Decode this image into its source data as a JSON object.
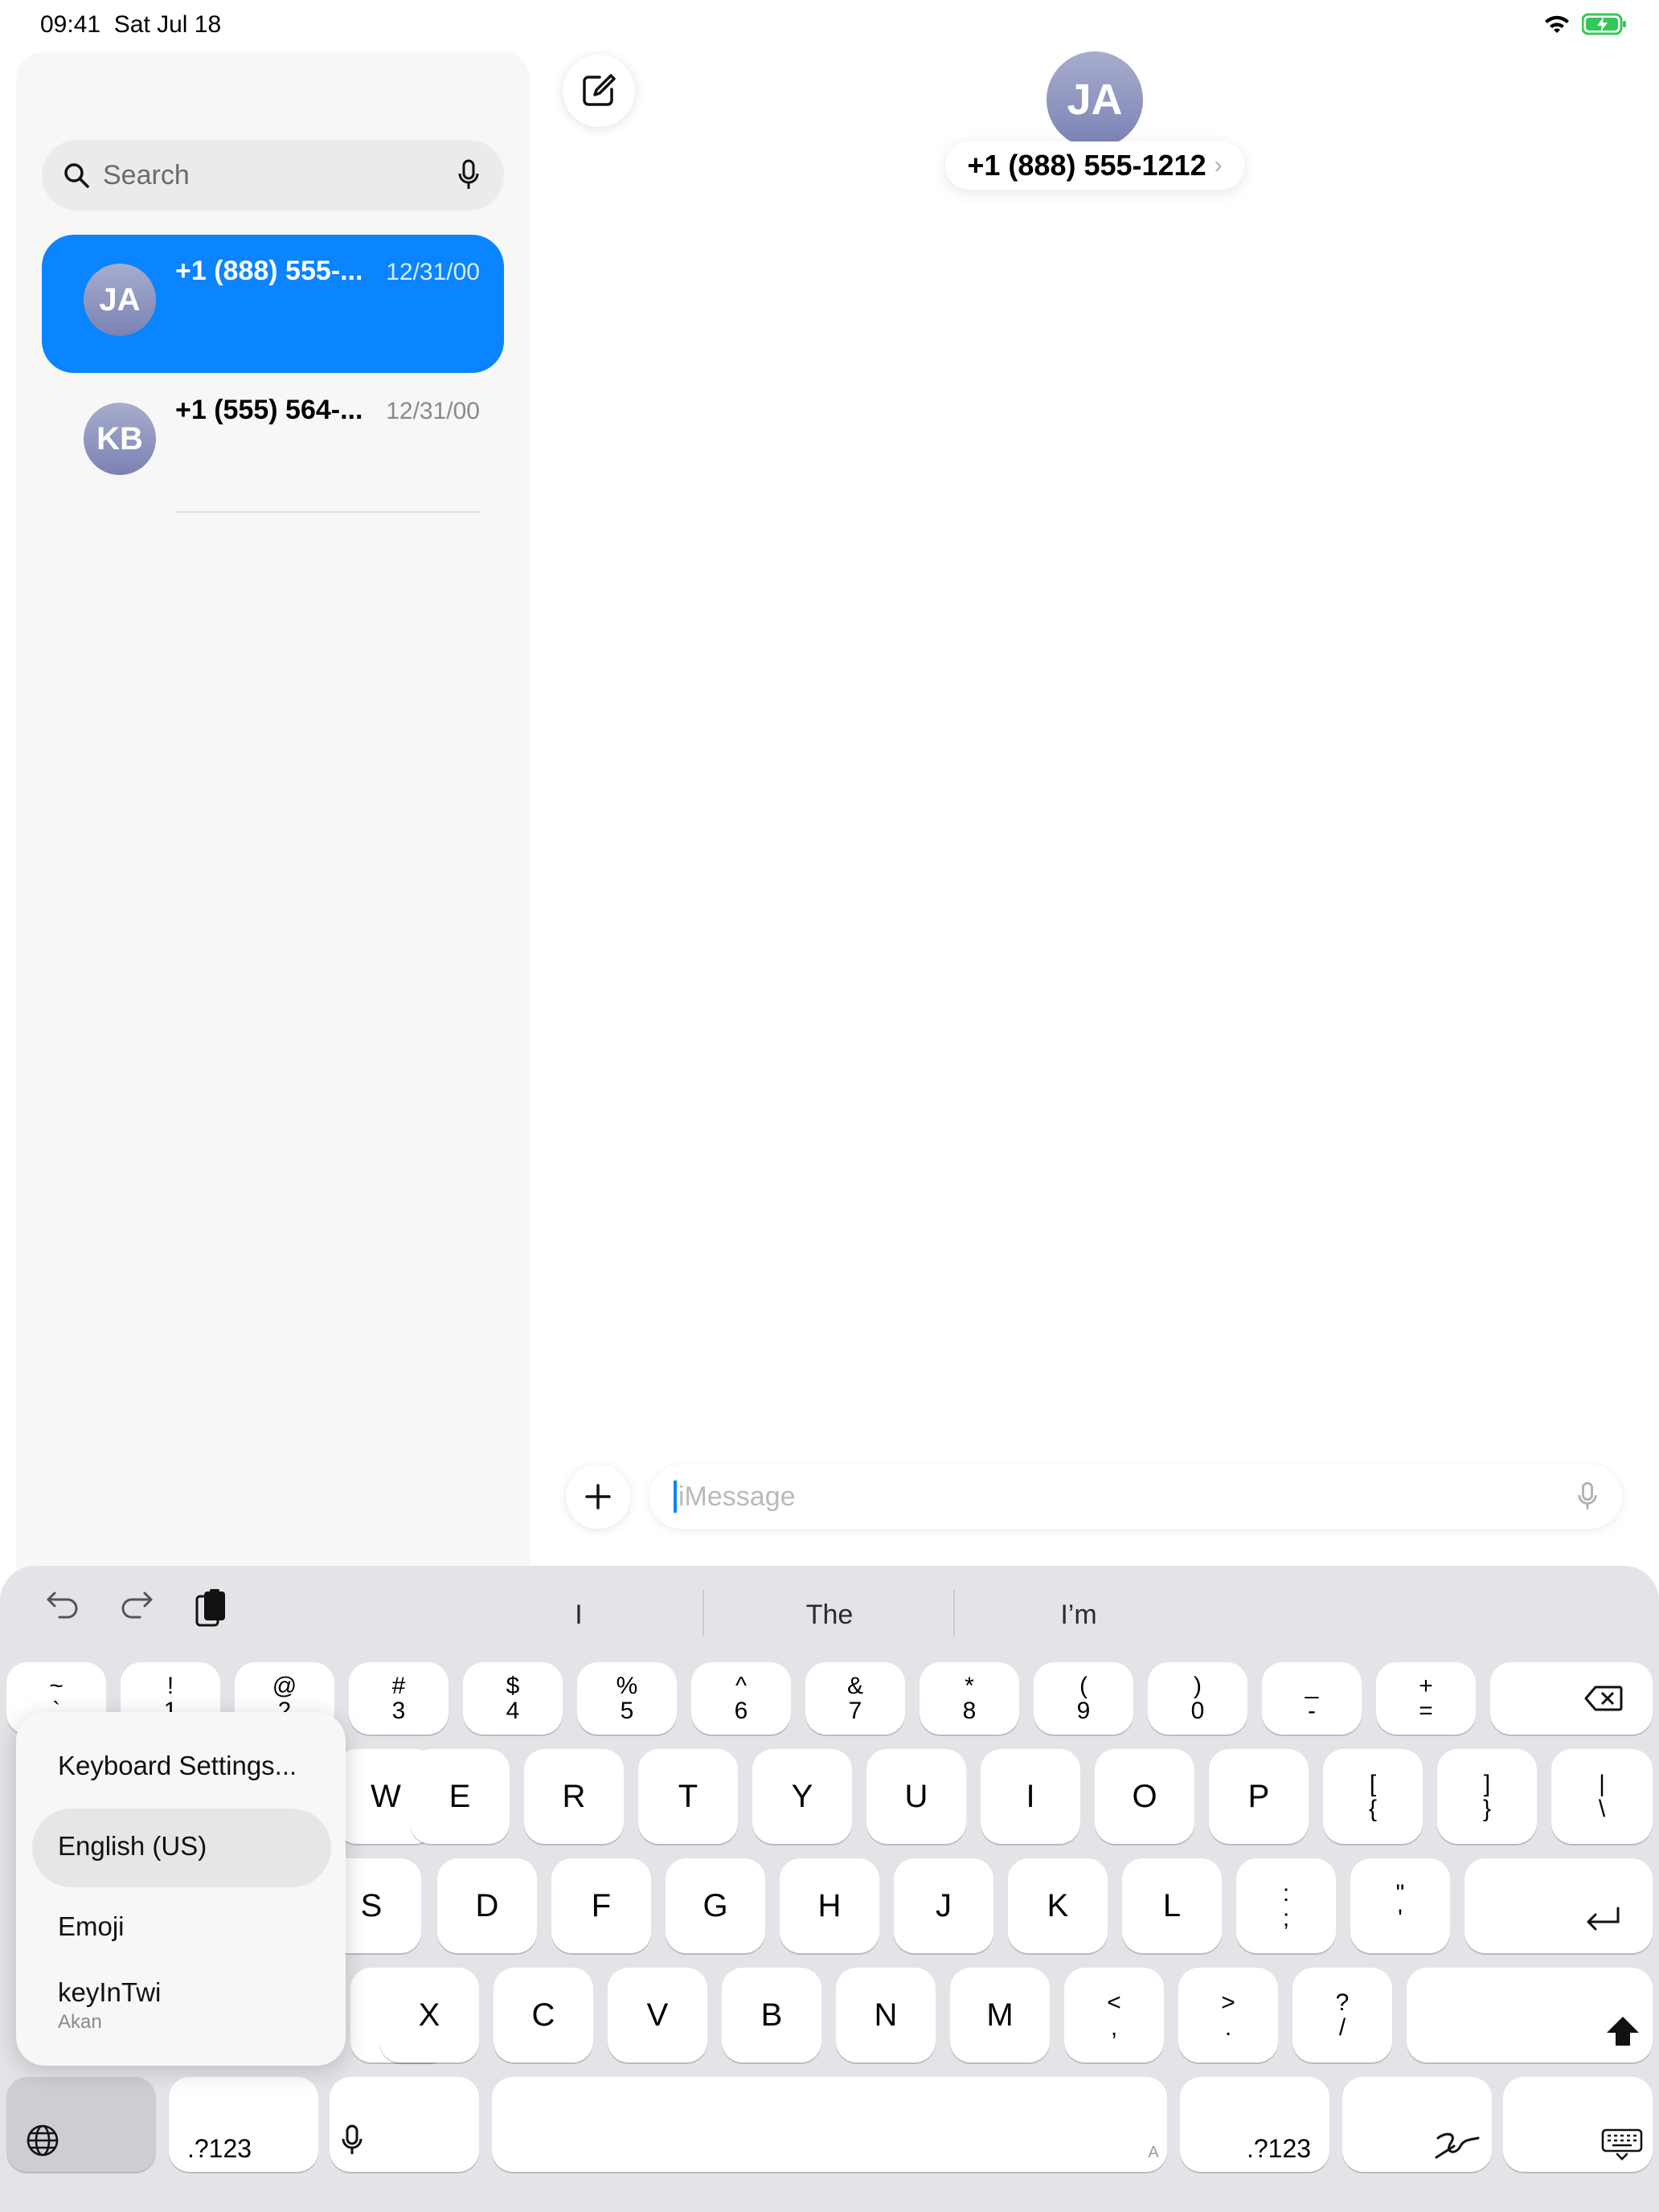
{
  "status": {
    "time": "09:41",
    "date": "Sat Jul 18"
  },
  "search": {
    "placeholder": "Search"
  },
  "conversations": [
    {
      "initials": "JA",
      "name": "+1 (888) 555-...",
      "date": "12/31/00",
      "selected": true
    },
    {
      "initials": "KB",
      "name": "+1 (555) 564-...",
      "date": "12/31/00",
      "selected": false
    }
  ],
  "header": {
    "initials": "JA",
    "name": "+1 (888) 555-1212",
    "chevron": "›"
  },
  "message": {
    "placeholder": "iMessage"
  },
  "suggestions": [
    "I",
    "The",
    "I’m"
  ],
  "keyboard": {
    "number_row": [
      {
        "top": "~",
        "bottom": "`"
      },
      {
        "top": "!",
        "bottom": "1"
      },
      {
        "top": "@",
        "bottom": "2"
      },
      {
        "top": "#",
        "bottom": "3"
      },
      {
        "top": "$",
        "bottom": "4"
      },
      {
        "top": "%",
        "bottom": "5"
      },
      {
        "top": "^",
        "bottom": "6"
      },
      {
        "top": "&",
        "bottom": "7"
      },
      {
        "top": "*",
        "bottom": "8"
      },
      {
        "top": "(",
        "bottom": "9"
      },
      {
        "top": ")",
        "bottom": "0"
      },
      {
        "top": "_",
        "bottom": "-"
      },
      {
        "top": "+",
        "bottom": "="
      }
    ],
    "row_q": [
      "W",
      "E",
      "R",
      "T",
      "Y",
      "U",
      "I",
      "O",
      "P"
    ],
    "row_q_sym": [
      {
        "top": "[",
        "bottom": "{"
      },
      {
        "top": "]",
        "bottom": "}"
      },
      {
        "top": "|",
        "bottom": "\\"
      }
    ],
    "row_a": [
      "S",
      "D",
      "F",
      "G",
      "H",
      "J",
      "K",
      "L"
    ],
    "row_a_sym": [
      {
        "top": ":",
        "bottom": ";"
      },
      {
        "top": "\"",
        "bottom": "'"
      }
    ],
    "row_z": [
      "X",
      "C",
      "V",
      "B",
      "N",
      "M"
    ],
    "row_z_sym": [
      {
        "top": "<",
        "bottom": ","
      },
      {
        "top": ">",
        "bottom": "."
      },
      {
        "top": "?",
        "bottom": "/"
      }
    ],
    "numbers_label": ".?123",
    "space_hint": "A"
  },
  "lang_popup": {
    "settings": "Keyboard Settings...",
    "english": "English (US)",
    "emoji": "Emoji",
    "twi": "keyInTwi",
    "twi_sub": "Akan"
  }
}
